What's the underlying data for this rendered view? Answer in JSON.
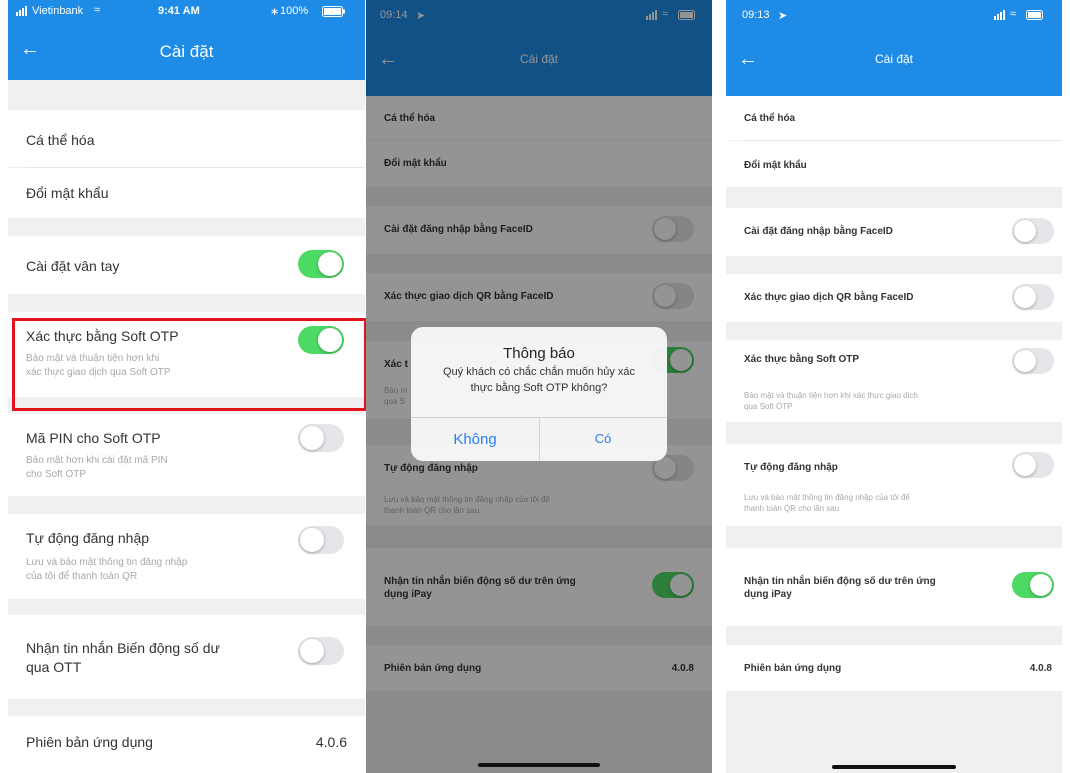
{
  "phone1": {
    "status": {
      "carrier": "Vietinbank",
      "time": "9:41 AM",
      "battery": "100%"
    },
    "nav_title": "Cài đặt",
    "items": {
      "personalize": "Cá thể hóa",
      "change_password": "Đổi mật khẩu",
      "fingerprint": "Cài đặt vân tay",
      "soft_otp": "Xác thực bằng Soft OTP",
      "soft_otp_sub_1": "Bảo mật và thuận tiện hơn khi",
      "soft_otp_sub_2": "xác thực giao dịch qua Soft OTP",
      "pin": "Mã PIN cho Soft OTP",
      "pin_sub_1": "Bảo mật hơn khi cài đặt mã PIN",
      "pin_sub_2": "cho Soft OTP",
      "auto_login": "Tự động đăng nhập",
      "auto_login_sub_1": "Lưu và bảo mật thông tin đăng nhập",
      "auto_login_sub_2": "của tôi để thanh toán QR",
      "balance_1": "Nhận tin nhắn Biến động số dư",
      "balance_2": "qua OTT",
      "version_label": "Phiên bản ứng dụng",
      "version_value": "4.0.6"
    }
  },
  "phone2": {
    "status": {
      "time": "09:14"
    },
    "nav_title": "Cài đặt",
    "items": {
      "personalize": "Cá thể hóa",
      "change_password": "Đổi mật khẩu",
      "faceid_login": "Cài đặt đăng nhập bằng FaceID",
      "faceid_qr": "Xác thực giao dịch QR bằng FaceID",
      "soft_otp_cut": "Xác t",
      "soft_otp_sub_cut_1": "Bảo m",
      "soft_otp_sub_cut_2": "qua S",
      "auto_login": "Tự động đăng nhập",
      "auto_login_sub_1": "Lưu và bảo mật thông tin đăng nhập của tôi để",
      "auto_login_sub_2": "thanh toán QR cho lần sau",
      "balance_1": "Nhận tin nhắn biến động số dư trên ứng",
      "balance_2": "dụng iPay",
      "version_label": "Phiên bản ứng dụng",
      "version_value": "4.0.8"
    },
    "dialog": {
      "title": "Thông báo",
      "message_1": "Quý khách có chắc chắn muốn hủy xác",
      "message_2": "thực bằng Soft OTP không?",
      "cancel": "Không",
      "confirm": "Có"
    }
  },
  "phone3": {
    "status": {
      "time": "09:13"
    },
    "nav_title": "Cài đặt",
    "items": {
      "personalize": "Cá thể hóa",
      "change_password": "Đổi mật khẩu",
      "faceid_login": "Cài đặt đăng nhập bằng FaceID",
      "faceid_qr": "Xác thực giao dịch QR bằng FaceID",
      "soft_otp": "Xác thực bằng Soft OTP",
      "soft_otp_sub_1": "Bảo mật và thuận tiện hơn khi xác thực giao dịch",
      "soft_otp_sub_2": "qua Soft OTP",
      "auto_login": "Tự động đăng nhập",
      "auto_login_sub_1": "Lưu và bảo mật thông tin đăng nhập của tôi để",
      "auto_login_sub_2": "thanh toán QR cho lần sau",
      "balance_1": "Nhận tin nhắn biến động số dư trên ứng",
      "balance_2": "dụng iPay",
      "version_label": "Phiên bản ứng dụng",
      "version_value": "4.0.8"
    }
  },
  "colors": {
    "nav": "#1e8ce6",
    "toggle_on": "#4cd964",
    "toggle_off": "#e5e5ea",
    "highlight": "#e0151b",
    "dialog_button": "#2a7ff0"
  },
  "icons": {
    "back": "arrow-left-icon",
    "wifi": "wifi-icon",
    "signal": "signal-icon",
    "battery": "battery-icon",
    "bluetooth": "bluetooth-icon",
    "location": "location-arrow-icon"
  }
}
